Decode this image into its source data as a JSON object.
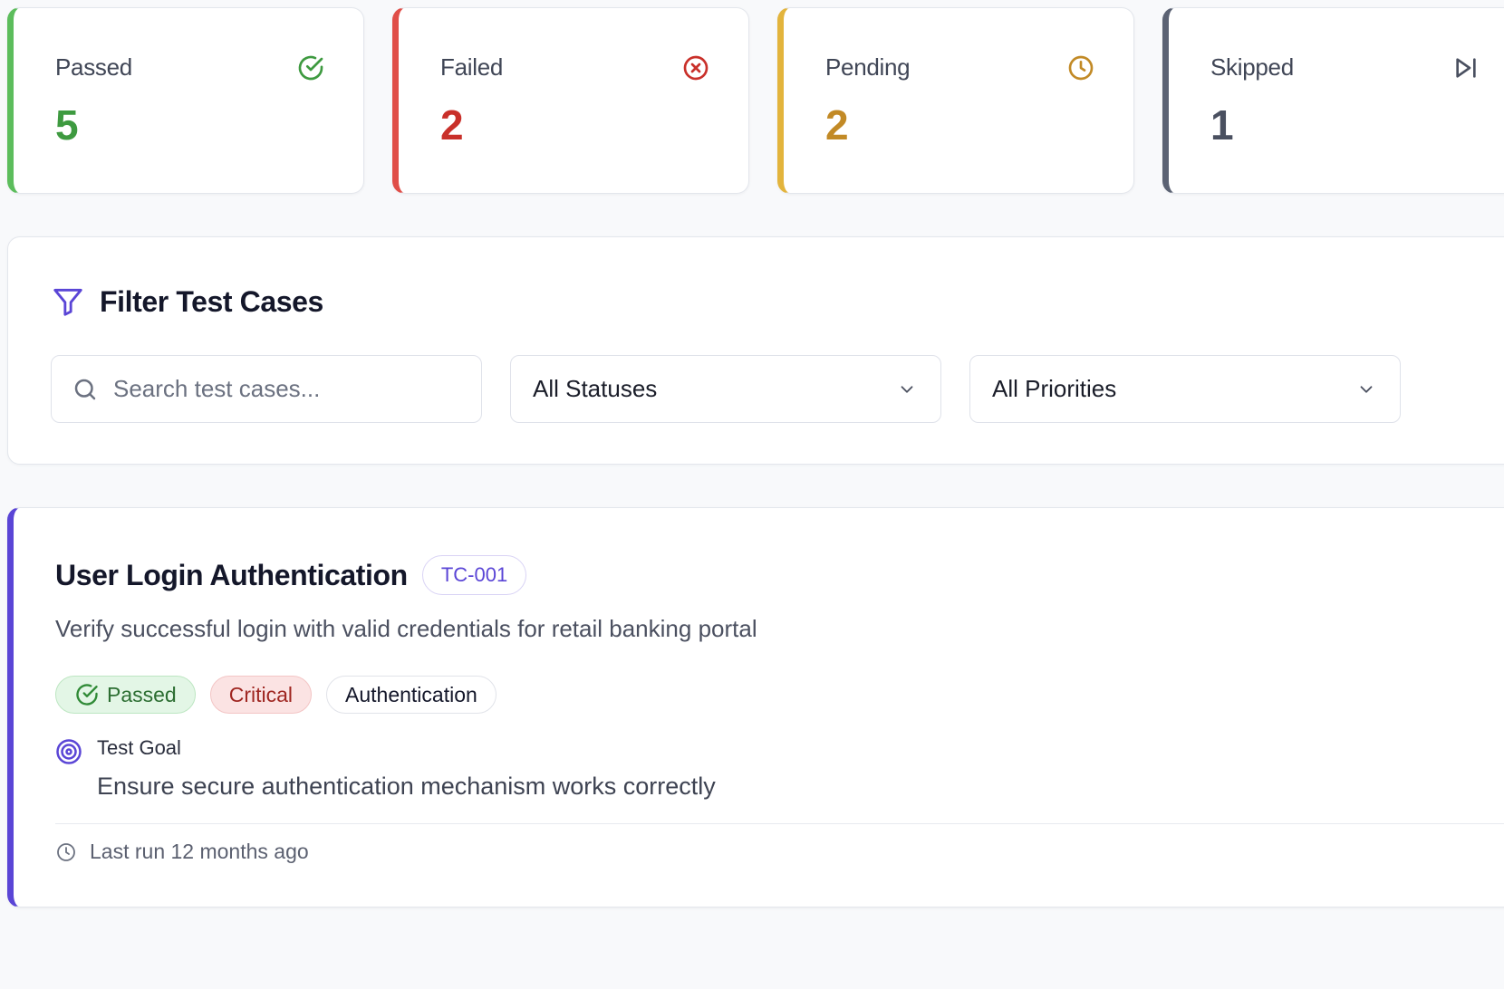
{
  "stats": [
    {
      "key": "passed",
      "label": "Passed",
      "value": "5",
      "icon": "check-circle-icon",
      "color": "#3e9a40"
    },
    {
      "key": "failed",
      "label": "Failed",
      "value": "2",
      "icon": "x-circle-icon",
      "color": "#c9302a"
    },
    {
      "key": "pending",
      "label": "Pending",
      "value": "2",
      "icon": "clock-icon",
      "color": "#c28a26"
    },
    {
      "key": "skipped",
      "label": "Skipped",
      "value": "1",
      "icon": "skip-icon",
      "color": "#4a5060"
    }
  ],
  "filter": {
    "title": "Filter Test Cases",
    "search_placeholder": "Search test cases...",
    "search_value": "",
    "status_select": "All Statuses",
    "priority_select": "All Priorities"
  },
  "test_case": {
    "title": "User Login Authentication",
    "id": "TC-001",
    "description": "Verify successful login with valid credentials for retail banking portal",
    "status": "Passed",
    "priority": "Critical",
    "category": "Authentication",
    "goal_label": "Test Goal",
    "goal_text": "Ensure secure authentication mechanism works correctly",
    "last_run": "Last run 12 months ago"
  },
  "colors": {
    "accent": "#5a45d6",
    "passed": "#5cbd5c",
    "failed": "#e04e48",
    "pending": "#e3b43c",
    "skipped": "#5b6273"
  }
}
